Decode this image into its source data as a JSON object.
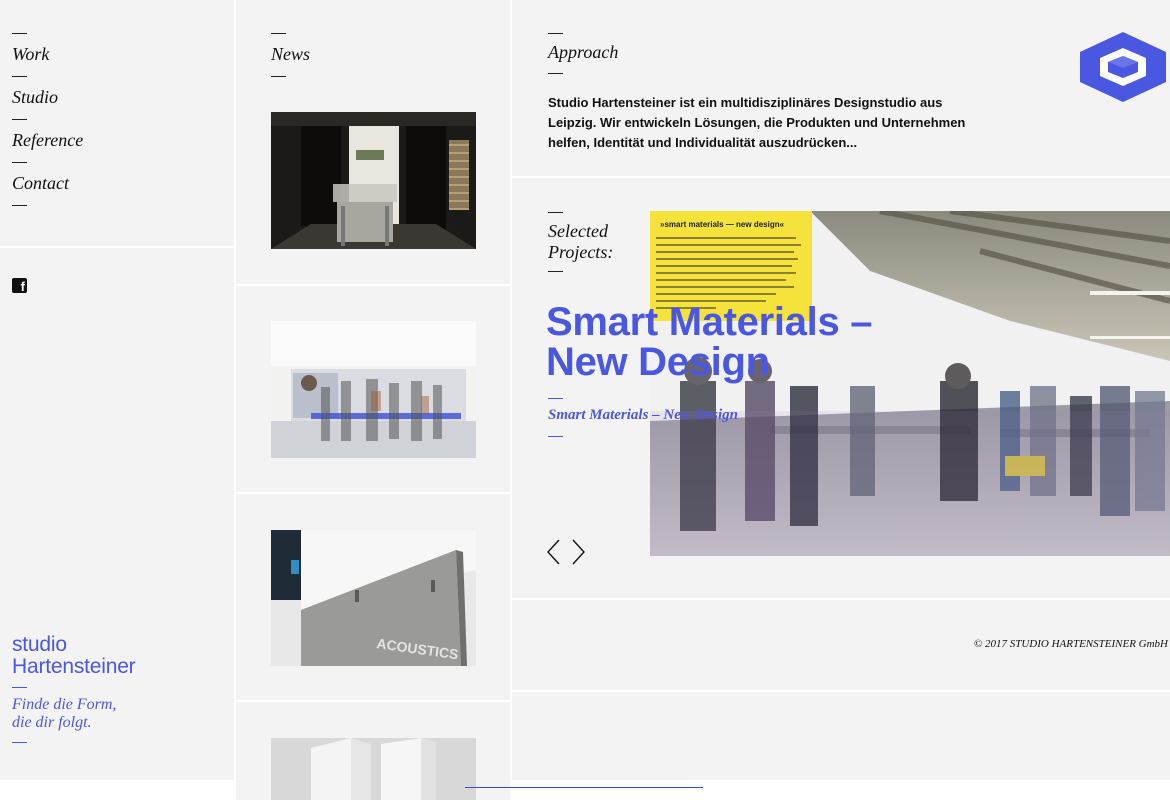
{
  "nav": {
    "items": [
      {
        "label": "Work"
      },
      {
        "label": "Studio"
      },
      {
        "label": "Reference"
      },
      {
        "label": "Contact"
      }
    ],
    "social_icon": "facebook-icon"
  },
  "brand": {
    "name_line1": "studio",
    "name_line2": "Hartensteiner",
    "tagline_line1": "Finde die Form,",
    "tagline_line2": "die dir folgt.",
    "accent_color": "#4a57e0"
  },
  "news": {
    "title": "News",
    "thumbnails": [
      "exhibition-room-photo",
      "motion-blur-crowd-photo",
      "acoustics-panel-photo",
      "white-panels-photo"
    ]
  },
  "approach": {
    "title": "Approach",
    "text": "Studio Hartensteiner ist ein multidisziplinäres Designstudio aus Leipzig. Wir entwickeln Lösungen, die Produkten und Unternehmen helfen, Identität und Individualität auszudrücken..."
  },
  "projects": {
    "label_line1": "Selected",
    "label_line2": "Projects:",
    "current_title_line1": "Smart Materials –",
    "current_title_line2": "New Design",
    "current_subtitle": "Smart Materials – New Design",
    "poster_heading": "»smart materials — new design«"
  },
  "footer": {
    "copyright": "© 2017  STUDIO HARTENSTEINER GmbH"
  }
}
